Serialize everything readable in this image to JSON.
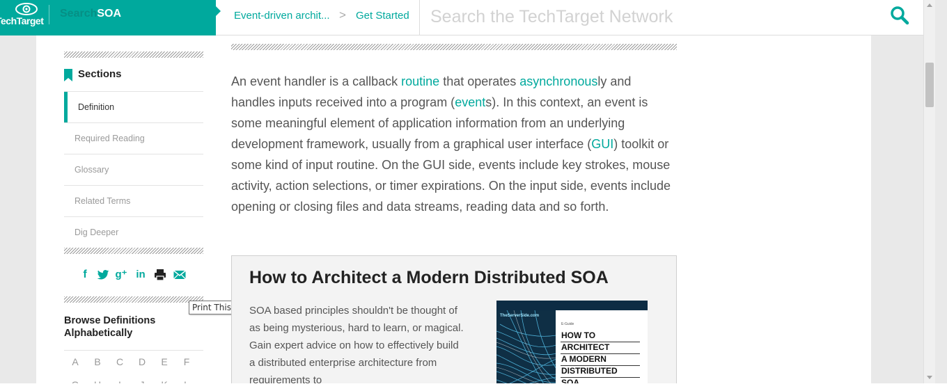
{
  "header": {
    "logo_text": "TechTarget",
    "site_name_prefix": "Search",
    "site_name_suffix": "SOA",
    "breadcrumb": [
      "Event-driven archit...",
      "Get Started"
    ],
    "breadcrumb_separator": ">",
    "search_placeholder": "Search the TechTarget Network",
    "search_icon": "search-icon"
  },
  "sidebar": {
    "sections_title": "Sections",
    "sections": [
      {
        "label": "Definition",
        "active": true
      },
      {
        "label": "Required Reading",
        "active": false
      },
      {
        "label": "Glossary",
        "active": false
      },
      {
        "label": "Related Terms",
        "active": false
      },
      {
        "label": "Dig Deeper",
        "active": false
      }
    ],
    "share_icons": [
      "facebook-icon",
      "twitter-icon",
      "google-plus-icon",
      "linkedin-icon",
      "print-icon",
      "email-icon"
    ],
    "share_glyphs": {
      "facebook": "f",
      "googleplus": "g⁺",
      "linkedin": "in"
    },
    "tooltip": "Print This Page",
    "browse_title": "Browse Definitions Alphabetically",
    "letters_row1": [
      "A",
      "B",
      "C",
      "D",
      "E",
      "F"
    ],
    "letters_row2": [
      "G",
      "H",
      "I",
      "J",
      "K",
      "L"
    ]
  },
  "article": {
    "p1": "An event handler is a callback ",
    "link_routine": "routine",
    "p2": " that operates ",
    "link_async": "asynchronous",
    "p3": "ly and handles inputs received into a program (",
    "link_event": "event",
    "p4": "s). In this context, an event is some meaningful element of application information from an underlying development framework, usually from a graphical user interface (",
    "link_gui": "GUI",
    "p5": ") toolkit or some kind of input routine. On the GUI side, events include key strokes, mouse activity, action selections, or timer expirations. On the input side, events include opening or closing files and data streams, reading data and so forth."
  },
  "promo": {
    "title": "How to Architect a Modern Distributed SOA",
    "text": "SOA based principles shouldn't be thought of as being mysterious, hard to learn, or magical. Gain expert advice on how to effectively build a distributed enterprise architecture from requirements to",
    "cover_brand": "TheServerSide.com",
    "cover_guide": "E-Guide",
    "cover_title_lines": [
      "HOW TO",
      "ARCHITECT",
      "A MODERN",
      "DISTRIBUTED",
      "SOA"
    ]
  },
  "colors": {
    "accent": "#00a99d",
    "text": "#555555",
    "heading": "#222222"
  }
}
